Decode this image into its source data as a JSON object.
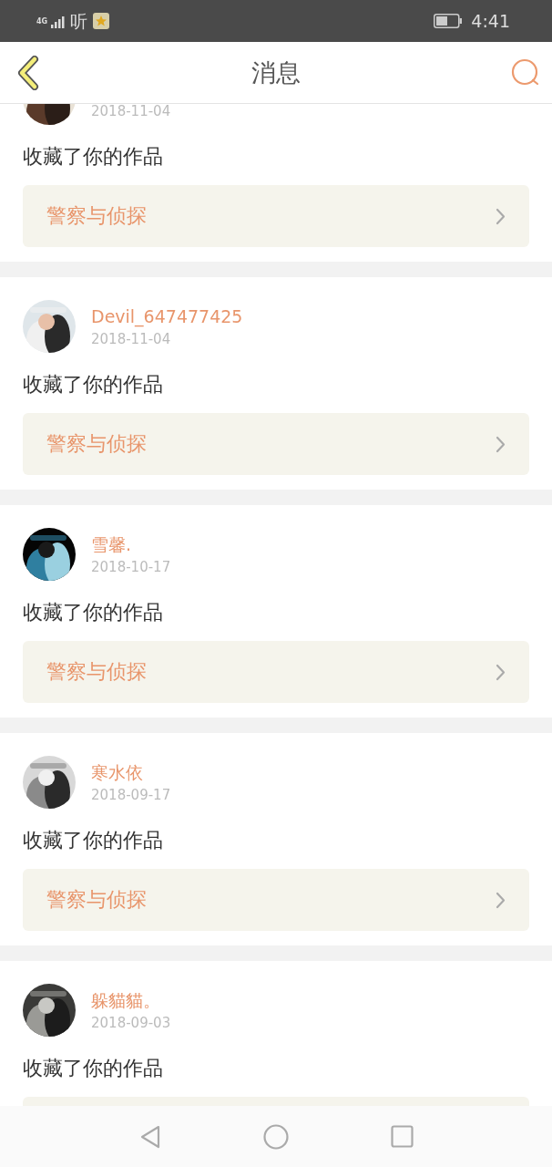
{
  "status_bar": {
    "network": "4G",
    "app_glyph": "听",
    "time": "4:41"
  },
  "header": {
    "title": "消息"
  },
  "messages": [
    {
      "date": "2018-11-04",
      "text": "收藏了你的作品",
      "work_title": "警察与侦探"
    },
    {
      "user": "Devil_647477425",
      "date": "2018-11-04",
      "text": "收藏了你的作品",
      "work_title": "警察与侦探"
    },
    {
      "user": "雪馨.",
      "date": "2018-10-17",
      "text": "收藏了你的作品",
      "work_title": "警察与侦探"
    },
    {
      "user": "寒水依",
      "date": "2018-09-17",
      "text": "收藏了你的作品",
      "work_title": "警察与侦探"
    },
    {
      "user": "躲貓貓。",
      "date": "2018-09-03",
      "text": "收藏了你的作品"
    }
  ]
}
